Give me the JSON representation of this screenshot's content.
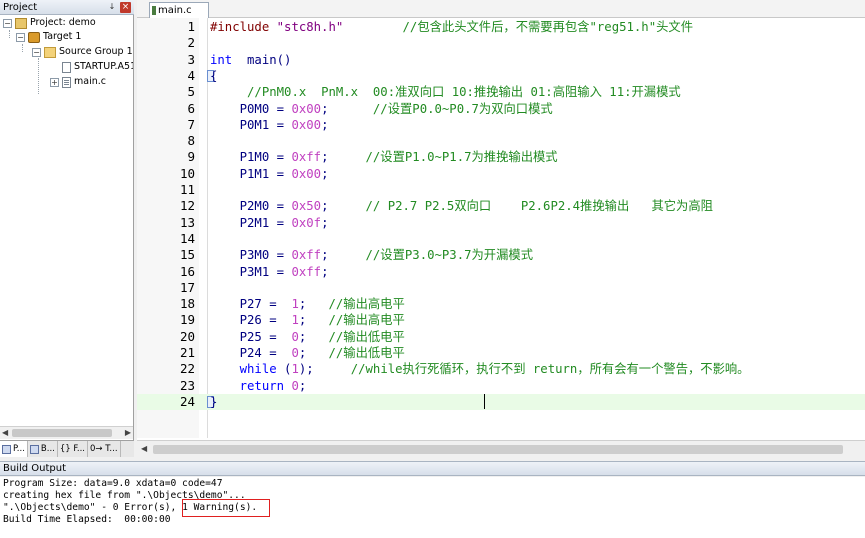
{
  "project": {
    "header_title": "Project",
    "pin_glyph": "↓",
    "close_glyph": "×",
    "tree": {
      "project_label": "Project: demo",
      "target_label": "Target 1",
      "group_label": "Source Group 1",
      "startup_file": "STARTUP.A51",
      "main_file": "main.c"
    },
    "tabs": [
      "P...",
      "B...",
      "{} F...",
      "0→ T..."
    ]
  },
  "editor": {
    "tab_label": "main.c",
    "line_numbers": [
      "1",
      "2",
      "3",
      "4",
      "5",
      "6",
      "7",
      "8",
      "9",
      "10",
      "11",
      "12",
      "13",
      "14",
      "15",
      "16",
      "17",
      "18",
      "19",
      "20",
      "21",
      "22",
      "23",
      "24"
    ],
    "current_line": 24
  },
  "build_output": {
    "title": "Build Output",
    "lines": {
      "size": "Program Size: data=9.0 xdata=0 code=47",
      "hex": "creating hex file from \".\\Objects\\demo\"...",
      "errors": "\".\\Objects\\demo\" - 0 Error(s), ",
      "warnings": "1 Warning(s).",
      "elapsed": "Build Time Elapsed:  00:00:00"
    }
  },
  "colors": {
    "keyword": "#0000ff",
    "string": "#800080",
    "number": "#c040c0",
    "comment": "#228b22",
    "highlight_box": "#e02020",
    "current_line_bg": "#e9fbe6"
  },
  "icons": [
    "project-icon",
    "target-icon",
    "folder-icon",
    "asm-file-icon",
    "c-file-icon",
    "close-icon",
    "pin-icon"
  ]
}
